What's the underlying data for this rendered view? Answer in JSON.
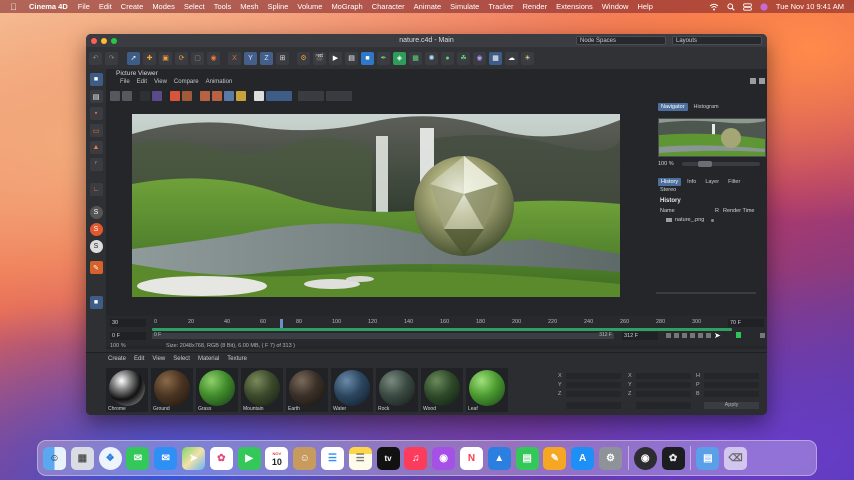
{
  "menubar": {
    "app": "Cinema 4D",
    "items": [
      "File",
      "Edit",
      "Create",
      "Modes",
      "Select",
      "Tools",
      "Mesh",
      "Spline",
      "Volume",
      "MoGraph",
      "Character",
      "Animate",
      "Simulate",
      "Tracker",
      "Render",
      "Extensions",
      "Window",
      "Help"
    ],
    "clock": "Tue Nov 10  9:41 AM"
  },
  "window": {
    "title": "nature.c4d - Main",
    "node_spaces": "Node Spaces",
    "layouts": "Layouts"
  },
  "picture_viewer": {
    "title": "Picture Viewer",
    "menu": [
      "File",
      "Edit",
      "View",
      "Compare",
      "Animation"
    ],
    "info": "Size: 2048x768, RGB (8 Bit), 6.00 MB,  ( F 7) of 313 )"
  },
  "navigator": {
    "tabs": [
      "Navigator",
      "Histogram"
    ],
    "zoom": "100 %",
    "sub_tabs": [
      "History",
      "Info",
      "Layer",
      "Filter"
    ],
    "stereo": "Stereo",
    "history_title": "History",
    "col_name": "Name",
    "col_r": "R",
    "col_time": "Render Time",
    "row_name": "nature_.png"
  },
  "timeline": {
    "frame_field": "30",
    "ticks": [
      "0",
      "20",
      "40",
      "60",
      "80",
      "100",
      "120",
      "140",
      "160",
      "180",
      "200",
      "220",
      "240",
      "260",
      "280",
      "300"
    ],
    "start": "0 F",
    "end": "312 F",
    "end2": "312 F",
    "end3": "70 F",
    "zoom": "100 %"
  },
  "materials": {
    "menu": [
      "Create",
      "Edit",
      "View",
      "Select",
      "Material",
      "Texture"
    ],
    "items": [
      {
        "name": "Chrome"
      },
      {
        "name": "Ground"
      },
      {
        "name": "Grass"
      },
      {
        "name": "Mountain"
      },
      {
        "name": "Earth"
      },
      {
        "name": "Water"
      },
      {
        "name": "Rock"
      },
      {
        "name": "Wood"
      },
      {
        "name": "Leaf"
      }
    ]
  },
  "attributes": {
    "x": "X",
    "y": "Y",
    "z": "Z",
    "h": "H",
    "p": "P",
    "b": "B",
    "apply": "Apply"
  },
  "dock": {
    "apps": [
      "finder-icon",
      "launchpad-icon",
      "safari-icon",
      "messages-icon",
      "mail-icon",
      "maps-icon",
      "photos-icon",
      "facetime-icon",
      "calendar-icon",
      "contacts-icon",
      "reminders-icon",
      "notes-icon",
      "apple-tv-icon",
      "music-icon",
      "podcasts-icon",
      "news-icon",
      "keynote-icon",
      "numbers-icon",
      "pages-icon",
      "app-store-icon",
      "system-preferences-icon",
      "cinema4d-icon",
      "davinci-icon",
      "folder-icon",
      "trash-icon"
    ],
    "calendar_day": "10",
    "calendar_month": "NOV",
    "tv_label": "tv"
  }
}
